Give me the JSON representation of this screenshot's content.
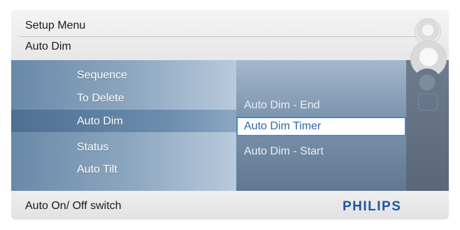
{
  "header": {
    "title": "Setup Menu",
    "subtitle": "Auto Dim"
  },
  "menu": {
    "items": [
      {
        "label": "Sequence"
      },
      {
        "label": "To Delete"
      },
      {
        "label": "Auto Dim",
        "selected": true
      },
      {
        "label": "Status"
      },
      {
        "label": "Auto Tilt"
      }
    ]
  },
  "submenu": {
    "items": [
      {
        "label": "Auto Dim - End"
      },
      {
        "label": "Auto Dim Timer",
        "selected": true
      },
      {
        "label": "Auto Dim - Start"
      }
    ]
  },
  "footer": {
    "hint": "Auto On/ Off switch",
    "brand": "PHILIPS"
  },
  "icons": [
    "settings-icon",
    "photo-icon",
    "slideshow-icon",
    "trash-icon"
  ],
  "colors": {
    "accent": "#4b86c8",
    "brand": "#1f56a3",
    "panel": "#8ea8c1"
  }
}
